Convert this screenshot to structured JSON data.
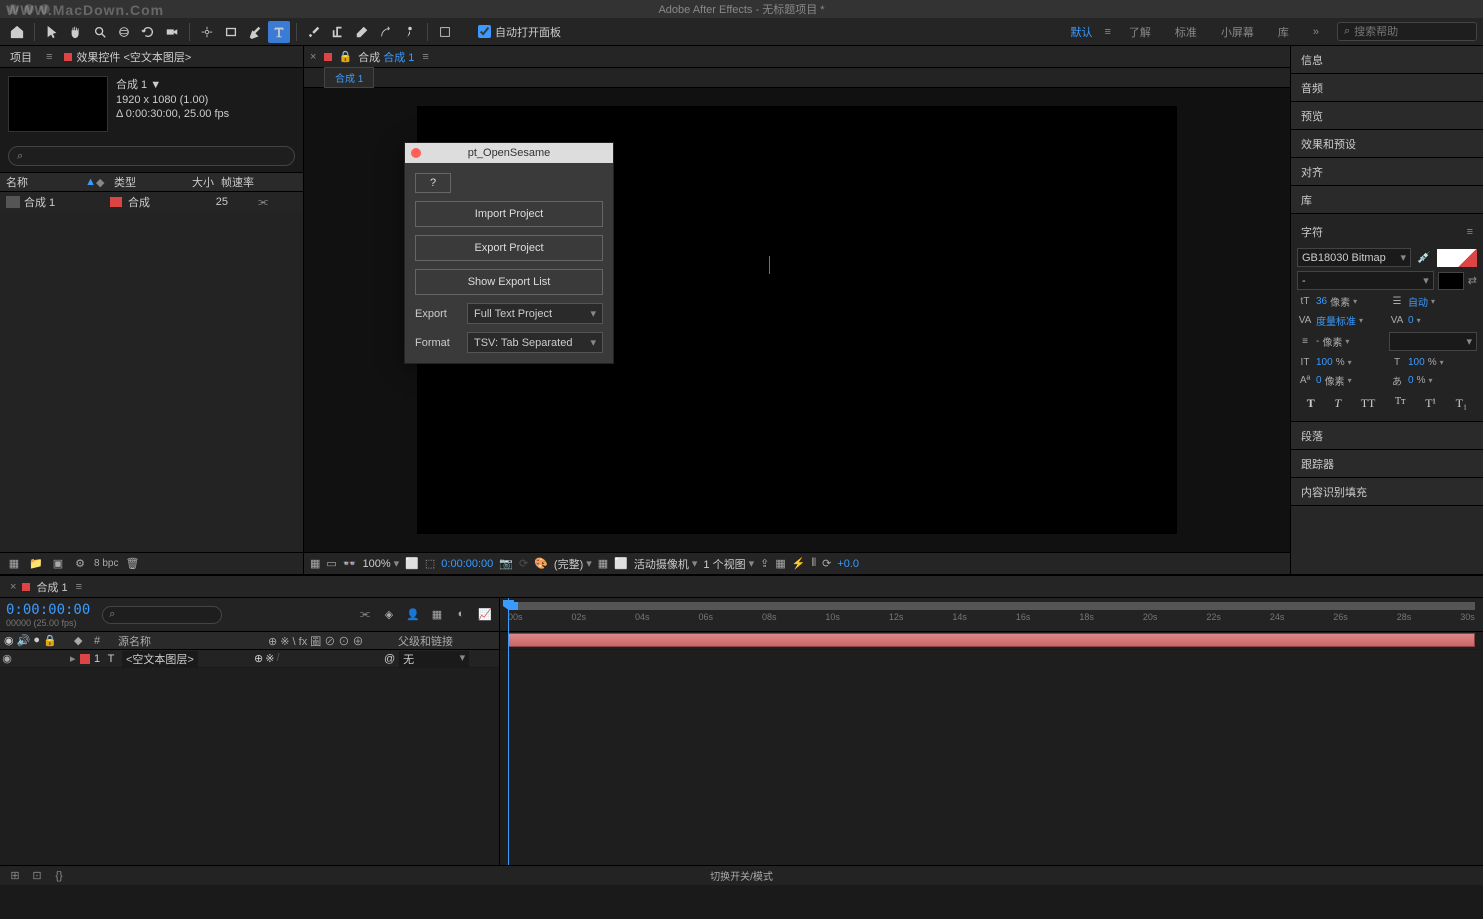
{
  "app": {
    "title": "Adobe After Effects - 无标题项目 *",
    "watermark": "WWW.MacDown.Com"
  },
  "toolbar": {
    "auto_open_panel": "自动打开面板",
    "workspaces": [
      "默认",
      "了解",
      "标准",
      "小屏幕",
      "库"
    ],
    "active_workspace": "默认",
    "search_placeholder": "搜索帮助"
  },
  "project_panel": {
    "tab_project": "项目",
    "tab_effects": "效果控件 <空文本图层>",
    "comp_name": "合成 1",
    "dimensions": "1920 x 1080 (1.00)",
    "duration": "Δ 0:00:30:00, 25.00 fps",
    "cols": {
      "name": "名称",
      "type": "类型",
      "size": "大小",
      "fps": "帧速率"
    },
    "row": {
      "name": "合成 1",
      "type": "合成",
      "size": "25"
    },
    "bpc": "8 bpc"
  },
  "comp_panel": {
    "tab_prefix": "合成",
    "tab_name": "合成 1",
    "subtab": "合成 1",
    "zoom": "100%",
    "time": "0:00:00:00",
    "resolution": "(完整)",
    "camera": "活动摄像机",
    "views": "1 个视图",
    "exposure": "+0.0"
  },
  "right_panels": {
    "info": "信息",
    "audio": "音频",
    "preview": "预览",
    "effects": "效果和预设",
    "align": "对齐",
    "libraries": "库",
    "character": "字符",
    "paragraph": "段落",
    "tracker": "跟踪器",
    "content_aware": "内容识别填充"
  },
  "character": {
    "font": "GB18030 Bitmap",
    "style": "-",
    "size": "36",
    "size_unit": "像素",
    "leading": "自动",
    "kerning": "度量标准",
    "tracking": "0",
    "stroke": "-",
    "stroke_unit": "像素",
    "vscale": "100",
    "vscale_unit": "%",
    "hscale": "100",
    "hscale_unit": "%",
    "baseline": "0",
    "baseline_unit": "像素",
    "tsume": "0",
    "tsume_unit": "%"
  },
  "timeline": {
    "tab": "合成 1",
    "timecode": "0:00:00:00",
    "timecode_sub": "00000 (25.00 fps)",
    "cols": {
      "num": "#",
      "source": "源名称",
      "switches": "⊕ ※ \\ fx 圖 ⊘ ⊙ ⊕",
      "parent": "父级和链接"
    },
    "layer": {
      "index": "1",
      "name": "<空文本图层>",
      "parent": "无"
    },
    "ruler": [
      "00s",
      "02s",
      "04s",
      "06s",
      "08s",
      "10s",
      "12s",
      "14s",
      "16s",
      "18s",
      "20s",
      "22s",
      "24s",
      "26s",
      "28s",
      "30s"
    ],
    "footer_toggle": "切换开关/模式"
  },
  "dialog": {
    "title": "pt_OpenSesame",
    "help": "?",
    "import": "Import Project",
    "export": "Export Project",
    "show_list": "Show Export List",
    "export_label": "Export",
    "export_value": "Full Text Project",
    "format_label": "Format",
    "format_value": "TSV: Tab Separated"
  }
}
